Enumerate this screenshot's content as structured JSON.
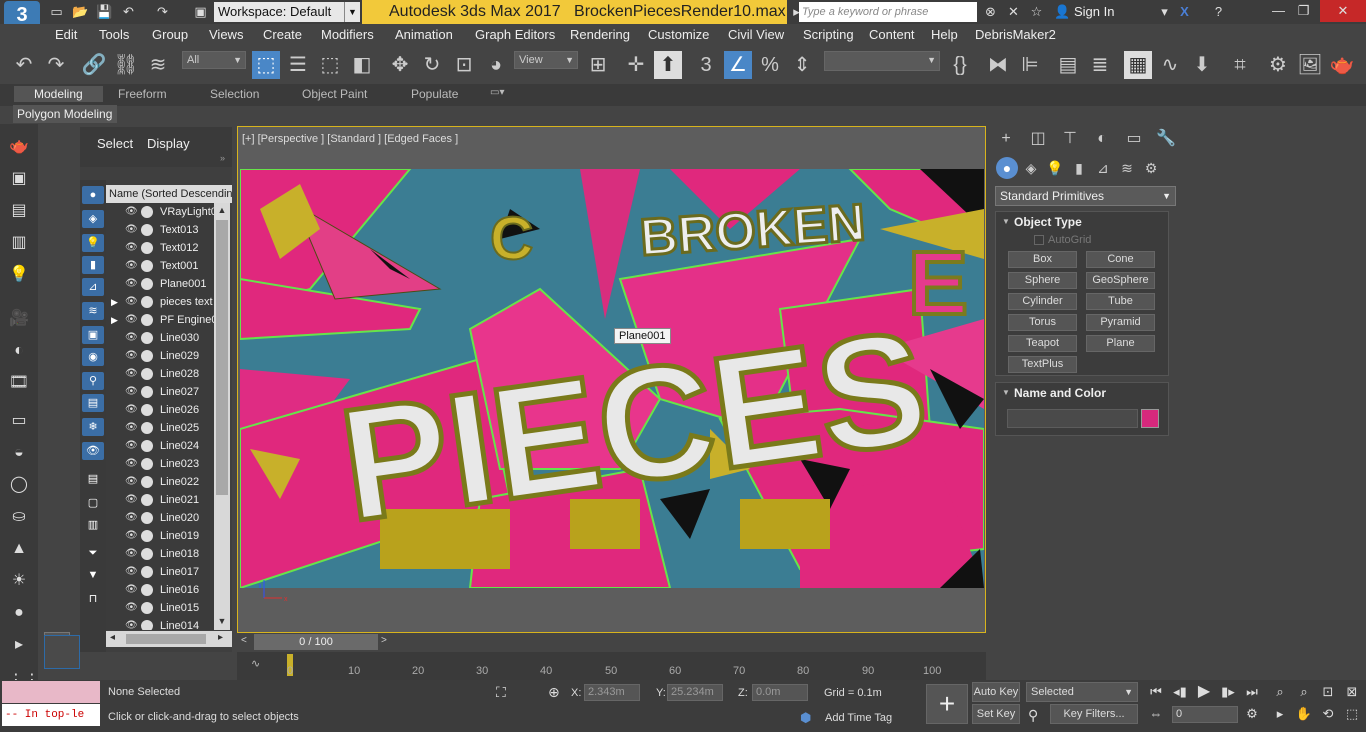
{
  "titlebar": {
    "workspace_label": "Workspace: Default",
    "app_title": "Autodesk 3ds Max 2017",
    "file_name": "BrockenPiecesRender10.max",
    "search_placeholder": "Type a keyword or phrase",
    "sign_in": "Sign In",
    "logo_text": "3"
  },
  "menubar": [
    "Edit",
    "Tools",
    "Group",
    "Views",
    "Create",
    "Modifiers",
    "Animation",
    "Graph Editors",
    "Rendering",
    "Customize",
    "Civil View",
    "Scripting",
    "Content",
    "Help",
    "DebrisMaker2"
  ],
  "toolbar": {
    "selection_filter": "All",
    "ref_coord": "View"
  },
  "ribbon": {
    "tabs": [
      "Modeling",
      "Freeform",
      "Selection",
      "Object Paint",
      "Populate"
    ],
    "active_tab": "Modeling",
    "sub_label": "Polygon Modeling"
  },
  "scene_explorer": {
    "tab_select": "Select",
    "tab_display": "Display",
    "column_header": "Name (Sorted Descending)",
    "rows": [
      "VRayLight0",
      "Text013",
      "Text012",
      "Text001",
      "Plane001",
      "pieces text",
      "PF Engine0",
      "Line030",
      "Line029",
      "Line028",
      "Line027",
      "Line026",
      "Line025",
      "Line024",
      "Line023",
      "Line022",
      "Line021",
      "Line020",
      "Line019",
      "Line018",
      "Line017",
      "Line016",
      "Line015",
      "Line014"
    ]
  },
  "viewport": {
    "label": "[+] [Perspective ] [Standard ] [Edged Faces ]",
    "tooltip": "Plane001",
    "word_broken": "BROKEN",
    "word_pieces": "PIECES",
    "letter_e": "E",
    "letter_c": "C"
  },
  "command_panel": {
    "category": "Standard Primitives",
    "object_type_title": "Object Type",
    "autogrid": "AutoGrid",
    "buttons": [
      "Box",
      "Cone",
      "Sphere",
      "GeoSphere",
      "Cylinder",
      "Tube",
      "Torus",
      "Pyramid",
      "Teapot",
      "Plane",
      "TextPlus"
    ],
    "name_color_title": "Name and Color",
    "object_color": "#d6287c"
  },
  "timeline": {
    "slider": "0 / 100",
    "ticks": [
      "0",
      "10",
      "20",
      "30",
      "40",
      "50",
      "60",
      "70",
      "80",
      "90",
      "100"
    ]
  },
  "status": {
    "maxscript_line": "-- In top-le",
    "selection": "None Selected",
    "prompt": "Click or click-and-drag to select objects",
    "x_label": "X:",
    "x_value": "2.343m",
    "y_label": "Y:",
    "y_value": "25.234m",
    "z_label": "Z:",
    "z_value": "0.0m",
    "grid": "Grid = 0.1m",
    "add_time_tag": "Add Time Tag",
    "auto_key": "Auto Key",
    "set_key": "Set Key",
    "key_mode": "Selected",
    "key_filters": "Key Filters...",
    "frame": "0"
  }
}
